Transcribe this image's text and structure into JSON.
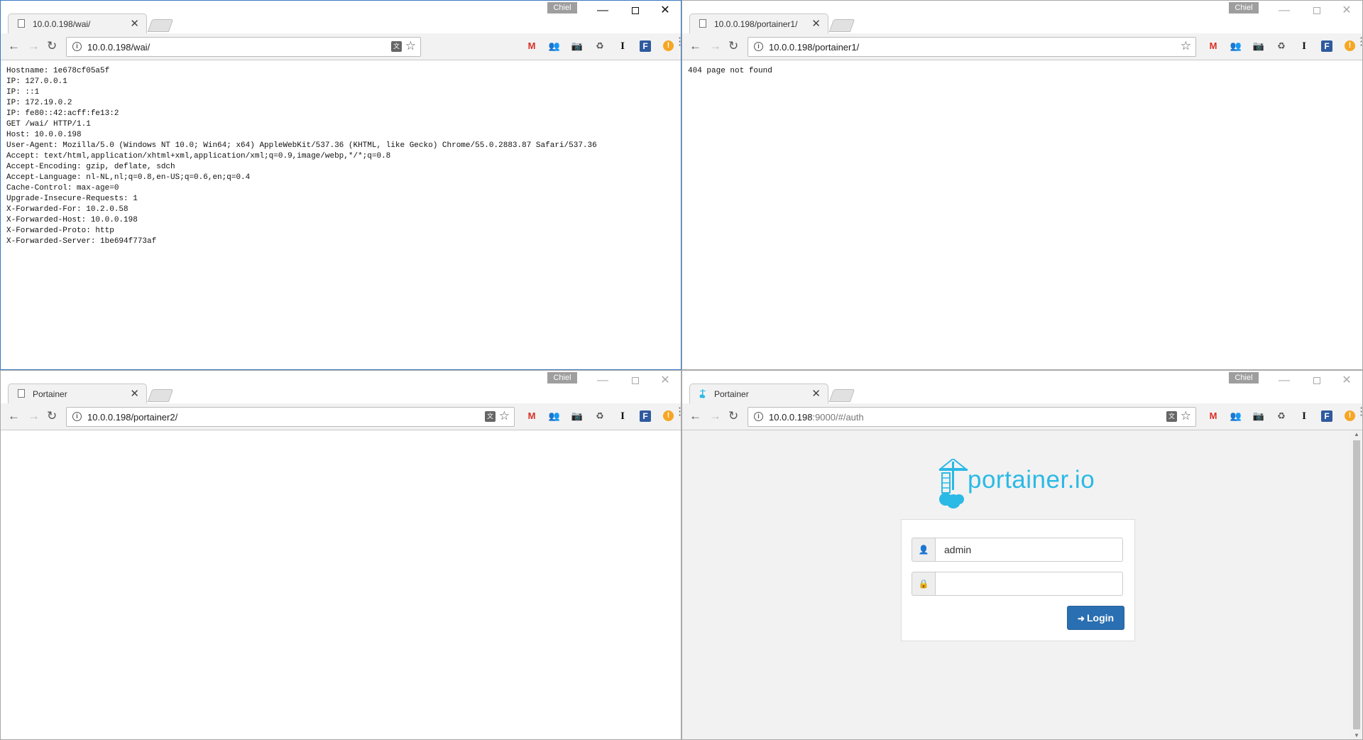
{
  "profile_name": "Chiel",
  "window_controls": {
    "minimize": "—",
    "close": "✕"
  },
  "windows": {
    "w1": {
      "tab_title": "10.0.0.198/wai/",
      "url": "10.0.0.198/wai/",
      "content_lines": "Hostname: 1e678cf05a5f\nIP: 127.0.0.1\nIP: ::1\nIP: 172.19.0.2\nIP: fe80::42:acff:fe13:2\nGET /wai/ HTTP/1.1\nHost: 10.0.0.198\nUser-Agent: Mozilla/5.0 (Windows NT 10.0; Win64; x64) AppleWebKit/537.36 (KHTML, like Gecko) Chrome/55.0.2883.87 Safari/537.36\nAccept: text/html,application/xhtml+xml,application/xml;q=0.9,image/webp,*/*;q=0.8\nAccept-Encoding: gzip, deflate, sdch\nAccept-Language: nl-NL,nl;q=0.8,en-US;q=0.6,en;q=0.4\nCache-Control: max-age=0\nUpgrade-Insecure-Requests: 1\nX-Forwarded-For: 10.2.0.58\nX-Forwarded-Host: 10.0.0.198\nX-Forwarded-Proto: http\nX-Forwarded-Server: 1be694f773af"
    },
    "w2": {
      "tab_title": "10.0.0.198/portainer1/",
      "url": "10.0.0.198/portainer1/",
      "content_text": "404 page not found"
    },
    "w3": {
      "tab_title": "Portainer",
      "url": "10.0.0.198/portainer2/"
    },
    "w4": {
      "tab_title": "Portainer",
      "url_host": "10.0.0.198",
      "url_rest": ":9000/#/auth",
      "logo_text": "portainer.io",
      "username_value": "admin",
      "password_value": "",
      "login_label": "Login"
    }
  },
  "icons": {
    "tab_close": "✕",
    "back": "←",
    "forward": "→",
    "reload": "↻",
    "info": "i",
    "translate": "文",
    "star": "☆",
    "gmail": "M",
    "people": "👥",
    "camera": "📷",
    "recycle": "♻",
    "ibeam": "I",
    "fbox": "F",
    "alert": "!",
    "menu": "⋮",
    "user": "👤",
    "lock": "🔒",
    "login_sign": "➜"
  },
  "colors": {
    "accent_active_border": "#3a78c3",
    "portainer_blue": "#2bb9e6",
    "login_button": "#2a6fb2"
  }
}
